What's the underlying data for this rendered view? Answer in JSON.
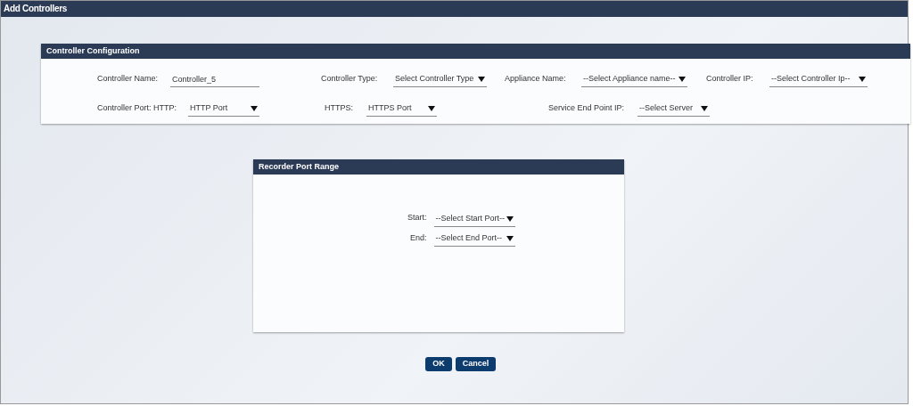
{
  "window": {
    "title": "Add Controllers"
  },
  "controller_configuration": {
    "title": "Controller Configuration",
    "rows": [
      [
        {
          "kind": "input",
          "label": "Controller Name:",
          "value": "Controller_5"
        },
        {
          "kind": "select",
          "label": "Controller Type:",
          "value": "Select Controller Type"
        },
        {
          "kind": "select",
          "label": "Appliance Name:",
          "value": "--Select Appliance name--"
        },
        {
          "kind": "select",
          "label": "Controller IP:",
          "value": "--Select Controller Ip--"
        }
      ],
      [
        {
          "kind": "select",
          "label": "Controller Port: HTTP:",
          "value": "HTTP Port"
        },
        {
          "kind": "select",
          "label": "HTTPS:",
          "value": "HTTPS Port"
        },
        {
          "kind": "select",
          "label": "Service End Point IP:",
          "value": "--Select Server"
        }
      ]
    ]
  },
  "recorder_port_range": {
    "title": "Recorder Port Range",
    "fields": [
      {
        "kind": "select",
        "label": "Start:",
        "value": "--Select Start Port--"
      },
      {
        "kind": "select",
        "label": "End:",
        "value": "--Select End Port--"
      }
    ]
  },
  "buttons": [
    "OK",
    "Cancel"
  ]
}
